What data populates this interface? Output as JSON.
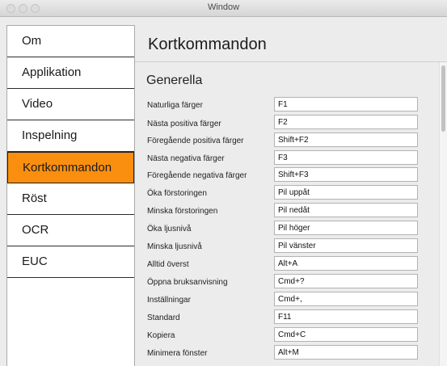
{
  "window": {
    "title": "Window"
  },
  "sidebar": {
    "items": [
      {
        "label": "Om",
        "selected": false
      },
      {
        "label": "Applikation",
        "selected": false
      },
      {
        "label": "Video",
        "selected": false
      },
      {
        "label": "Inspelning",
        "selected": false
      },
      {
        "label": "Kortkommandon",
        "selected": true
      },
      {
        "label": "Röst",
        "selected": false
      },
      {
        "label": "OCR",
        "selected": false
      },
      {
        "label": "EUC",
        "selected": false
      }
    ]
  },
  "main": {
    "title": "Kortkommandon",
    "section_title": "Generella",
    "shortcuts": [
      {
        "label": "Naturliga färger",
        "value": "F1"
      },
      {
        "label": "Nästa positiva färger",
        "value": "F2"
      },
      {
        "label": "Föregående positiva färger",
        "value": "Shift+F2"
      },
      {
        "label": "Nästa negativa färger",
        "value": "F3"
      },
      {
        "label": "Föregående negativa färger",
        "value": "Shift+F3"
      },
      {
        "label": "Öka förstoringen",
        "value": "Pil uppåt"
      },
      {
        "label": "Minska förstoringen",
        "value": "Pil nedåt"
      },
      {
        "label": "Öka ljusnivå",
        "value": "Pil höger"
      },
      {
        "label": "Minska ljusnivå",
        "value": "Pil vänster"
      },
      {
        "label": "Alltid överst",
        "value": "Alt+A"
      },
      {
        "label": "Öppna bruksanvisning",
        "value": "Cmd+?"
      },
      {
        "label": "Inställningar",
        "value": "Cmd+,"
      },
      {
        "label": "Standard",
        "value": "F11"
      },
      {
        "label": "Kopiera",
        "value": "Cmd+C"
      },
      {
        "label": "Minimera fönster",
        "value": "Alt+M"
      }
    ]
  },
  "colors": {
    "selected_bg": "#fa8f0f",
    "window_bg": "#ececec"
  }
}
